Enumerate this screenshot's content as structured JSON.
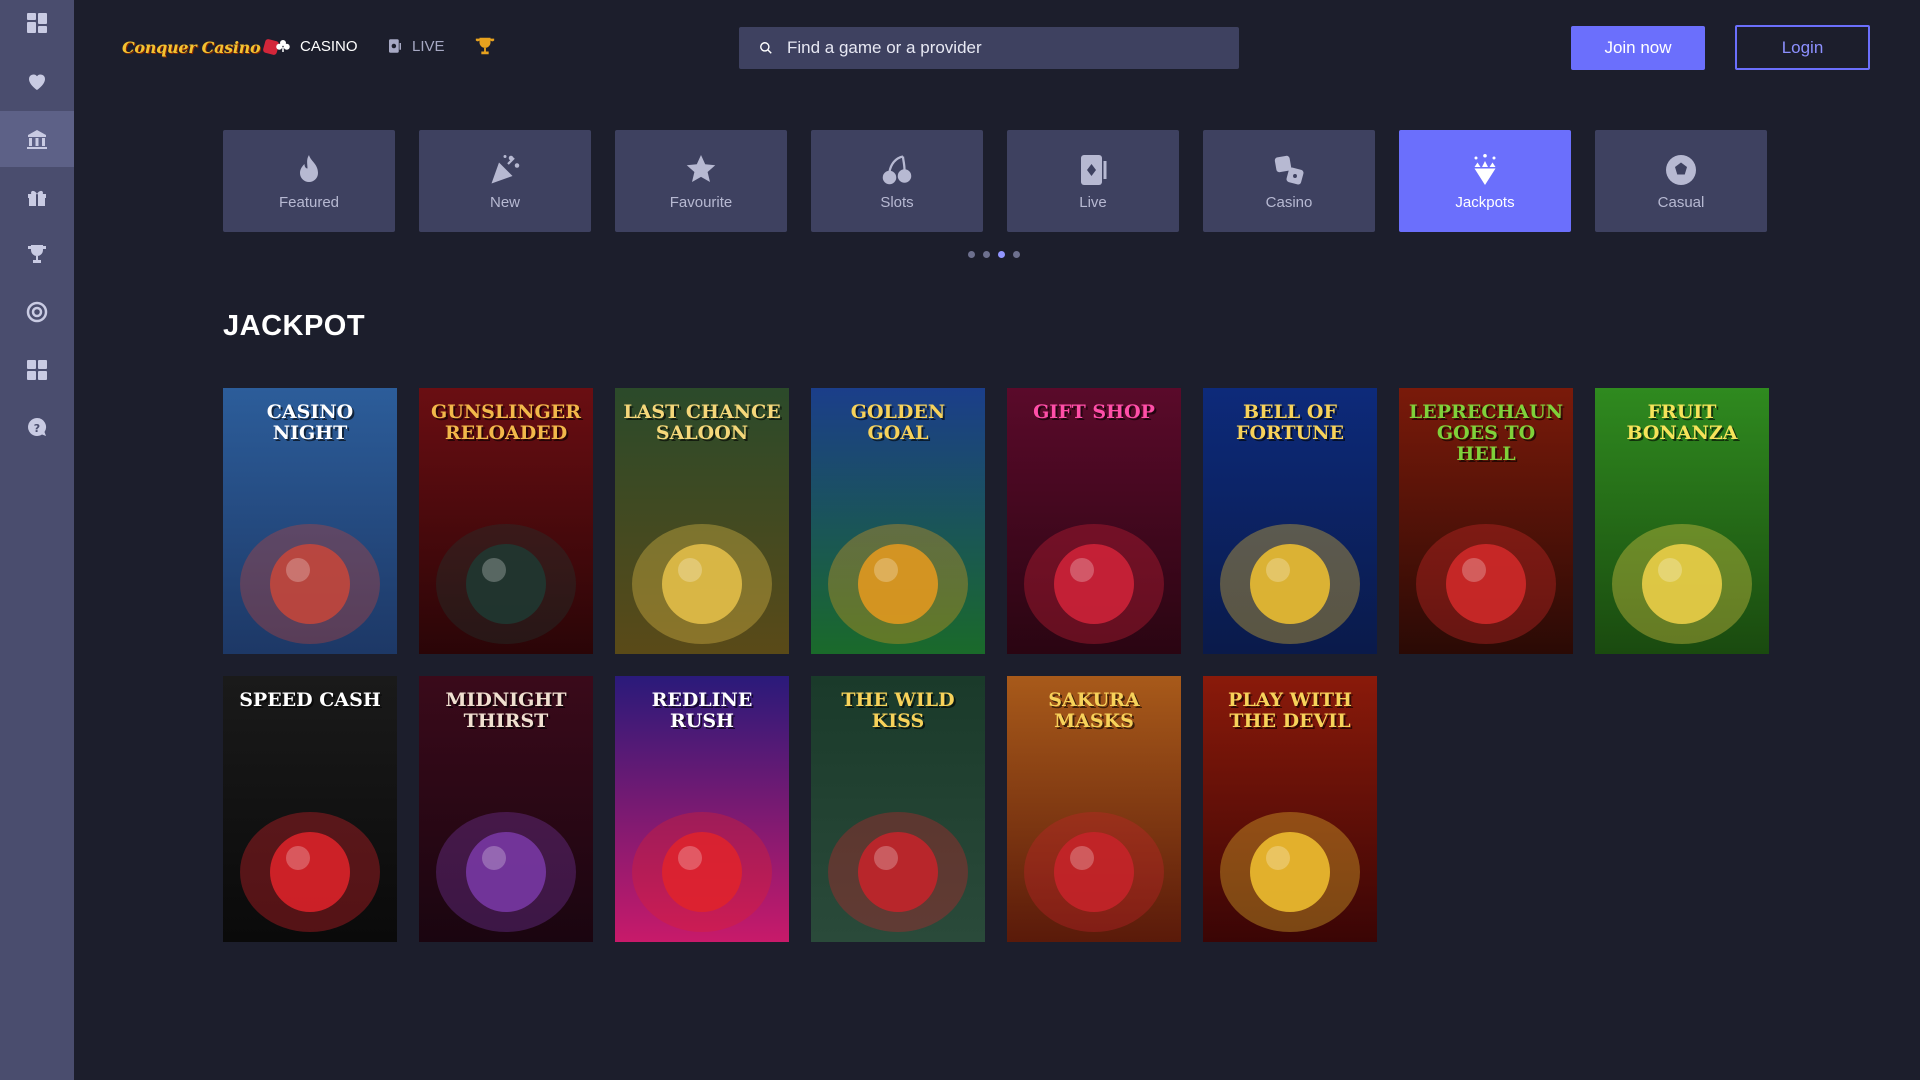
{
  "header": {
    "logo_text": "Conquer Casino",
    "nav": [
      {
        "label": "CASINO",
        "icon": "cards-icon"
      },
      {
        "label": "LIVE",
        "icon": "live-card-icon"
      },
      {
        "label": "",
        "icon": "trophy-icon"
      }
    ],
    "search": {
      "placeholder": "Find a game or a provider"
    },
    "join_label": "Join now",
    "login_label": "Login"
  },
  "sidebar": {
    "items": [
      {
        "icon": "dashboard-icon"
      },
      {
        "icon": "heart-icon"
      },
      {
        "icon": "casino-building-icon",
        "active": true
      },
      {
        "icon": "gift-icon"
      },
      {
        "icon": "trophy-icon"
      },
      {
        "icon": "target-icon"
      },
      {
        "icon": "grid-icon"
      },
      {
        "icon": "help-chat-icon"
      }
    ]
  },
  "categories": [
    {
      "label": "Featured",
      "icon": "flame-icon"
    },
    {
      "label": "New",
      "icon": "party-popper-icon"
    },
    {
      "label": "Favourite",
      "icon": "star-icon"
    },
    {
      "label": "Slots",
      "icon": "cherries-icon"
    },
    {
      "label": "Live",
      "icon": "live-card-icon"
    },
    {
      "label": "Casino",
      "icon": "dice-icon"
    },
    {
      "label": "Jackpots",
      "icon": "diamond-icon",
      "active": true
    },
    {
      "label": "Casual",
      "icon": "ball-icon"
    }
  ],
  "carousel": {
    "pages": 4,
    "active_page": 3
  },
  "section_title": "JACKPOT",
  "games": [
    {
      "title": "Casino Night",
      "bg_top": "#2c5d9a",
      "bg_bottom": "#1d3866",
      "accent": "#c8463a",
      "title_color": "#ffffff"
    },
    {
      "title": "Gunslinger Reloaded",
      "bg_top": "#6a0e12",
      "bg_bottom": "#2a0507",
      "accent": "#1f3a33",
      "title_color": "#f2b84a"
    },
    {
      "title": "Last Chance Saloon",
      "bg_top": "#2b4a2a",
      "bg_bottom": "#5a4a18",
      "accent": "#e8c24a",
      "title_color": "#f5d77a"
    },
    {
      "title": "Golden Goal",
      "bg_top": "#1b3e8a",
      "bg_bottom": "#1a6a2a",
      "accent": "#e79a1e",
      "title_color": "#f7d25a"
    },
    {
      "title": "Gift Shop",
      "bg_top": "#5a0a2a",
      "bg_bottom": "#2a0512",
      "accent": "#d2233a",
      "title_color": "#ff4fa8"
    },
    {
      "title": "Bell of Fortune",
      "bg_top": "#0d2a7a",
      "bg_bottom": "#0a1a4a",
      "accent": "#f2c230",
      "title_color": "#f7d25a"
    },
    {
      "title": "Leprechaun goes to Hell",
      "bg_top": "#7a1a0a",
      "bg_bottom": "#2a0a05",
      "accent": "#d42a2a",
      "title_color": "#7fd13a"
    },
    {
      "title": "Fruit Bonanza",
      "bg_top": "#2f8a1f",
      "bg_bottom": "#1a4a0f",
      "accent": "#f2d24a",
      "title_color": "#f7e35a"
    },
    {
      "title": "Speed Cash",
      "bg_top": "#1a1a1a",
      "bg_bottom": "#0a0a0a",
      "accent": "#e0232a",
      "title_color": "#ffffff"
    },
    {
      "title": "Midnight Thirst",
      "bg_top": "#3a0a1a",
      "bg_bottom": "#1a0510",
      "accent": "#7a3aa8",
      "title_color": "#f0e0d0"
    },
    {
      "title": "Redline Rush",
      "bg_top": "#2a1a7a",
      "bg_bottom": "#c81a6a",
      "accent": "#e0232a",
      "title_color": "#ffffff"
    },
    {
      "title": "The Wild Kiss",
      "bg_top": "#1a3a2a",
      "bg_bottom": "#2a4a3a",
      "accent": "#c8232a",
      "title_color": "#f7d25a"
    },
    {
      "title": "Sakura Masks",
      "bg_top": "#a85a1a",
      "bg_bottom": "#5a1a0a",
      "accent": "#c8232a",
      "title_color": "#f7d25a"
    },
    {
      "title": "Play with the Devil",
      "bg_top": "#8a1a0a",
      "bg_bottom": "#3a0505",
      "accent": "#f2c230",
      "title_color": "#f7d25a"
    }
  ]
}
